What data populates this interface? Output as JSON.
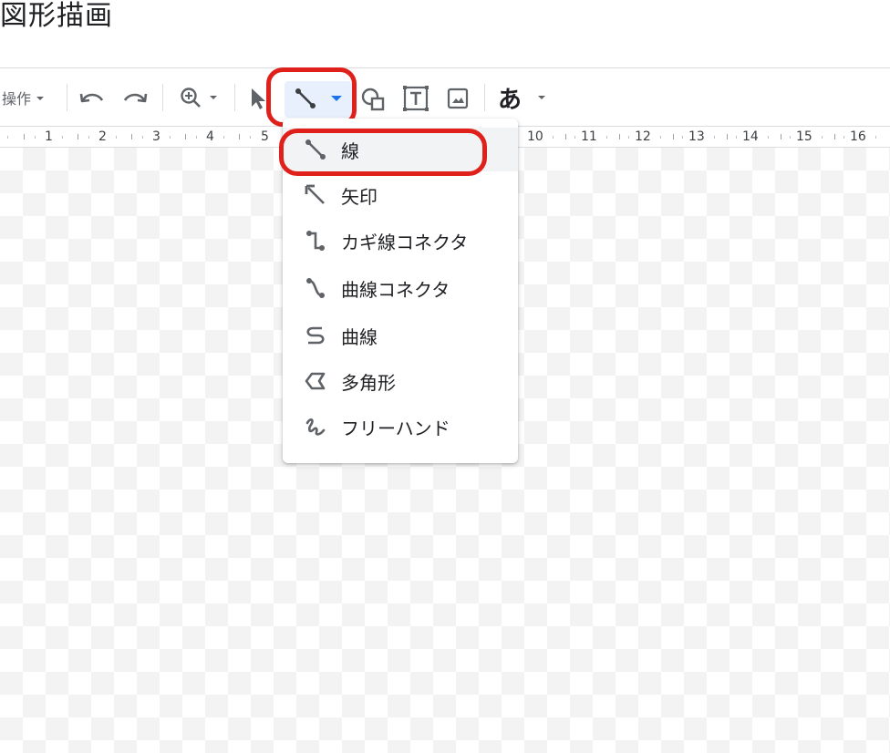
{
  "page": {
    "title": "図形描画"
  },
  "toolbar": {
    "actions_label": "操作",
    "font_glyph": "あ",
    "icons": [
      "undo-icon",
      "redo-icon",
      "zoom-icon",
      "select-cursor-icon",
      "line-tool-icon",
      "dropdown-arrow-icon",
      "shape-icon",
      "text-box-icon",
      "image-icon"
    ]
  },
  "ruler": {
    "numbers": [
      "1",
      "2",
      "3",
      "4",
      "5",
      "10",
      "11",
      "12",
      "13",
      "14",
      "15",
      "16"
    ]
  },
  "line_menu": {
    "items": [
      {
        "label": "線",
        "icon": "line-icon",
        "active": true
      },
      {
        "label": "矢印",
        "icon": "arrow-icon"
      },
      {
        "label": "カギ線コネクタ",
        "icon": "elbow-connector-icon"
      },
      {
        "label": "曲線コネクタ",
        "icon": "curved-connector-icon"
      },
      {
        "label": "曲線",
        "icon": "curve-icon"
      },
      {
        "label": "多角形",
        "icon": "polyline-icon"
      },
      {
        "label": "フリーハンド",
        "icon": "scribble-icon"
      }
    ]
  },
  "colors": {
    "highlight": "#e0201b",
    "accent": "#1a73e8",
    "active_bg": "#e8f0fe"
  }
}
